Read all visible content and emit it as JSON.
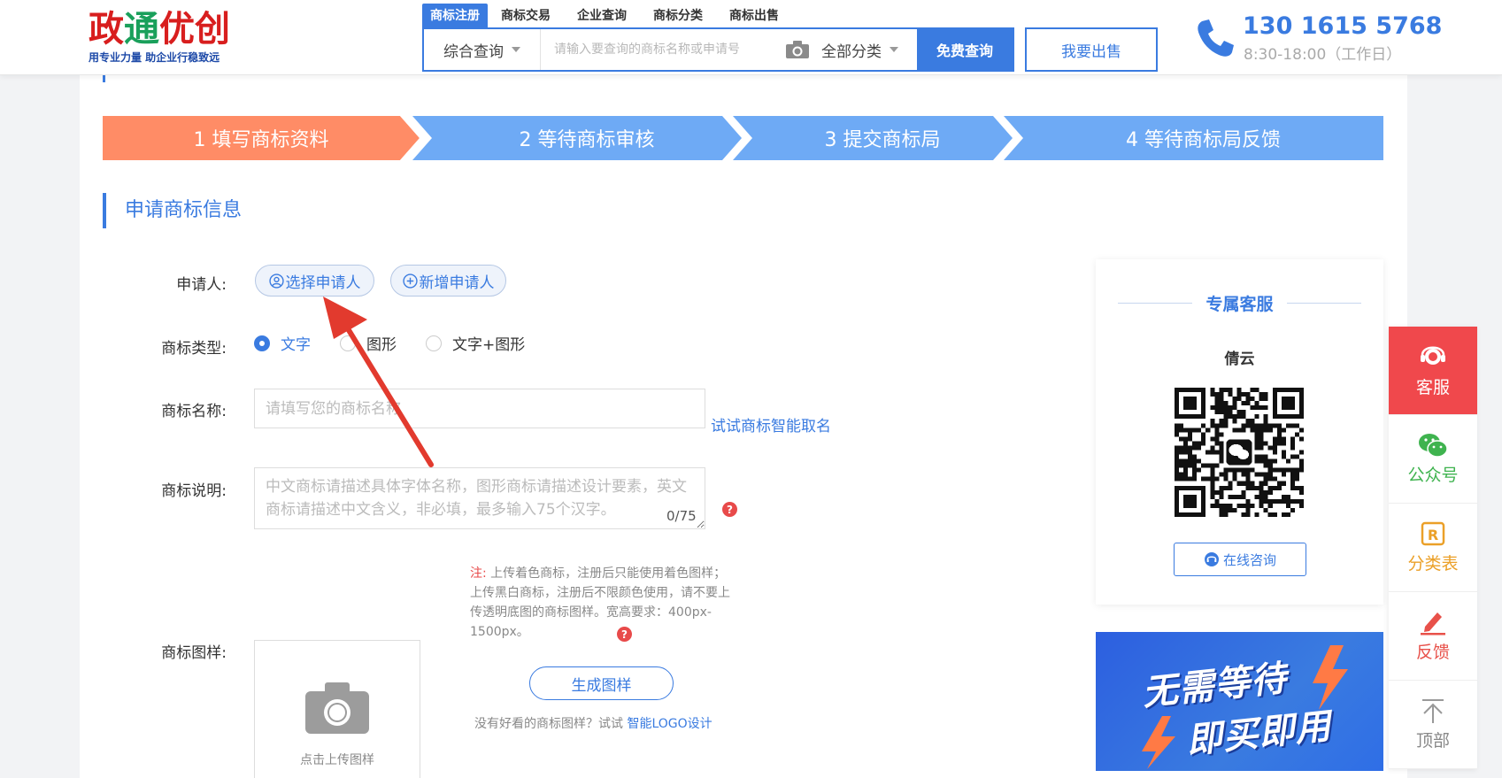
{
  "header": {
    "logo": {
      "title_part1": "政",
      "title_part2": "通",
      "title_part3": "优创",
      "slogan": "用专业力量  助企业行稳致远"
    },
    "tabs": [
      {
        "label": "商标注册",
        "active": true
      },
      {
        "label": "商标交易",
        "active": false
      },
      {
        "label": "企业查询",
        "active": false
      },
      {
        "label": "商标分类",
        "active": false
      },
      {
        "label": "商标出售",
        "active": false
      }
    ],
    "search": {
      "category": "综合查询",
      "placeholder": "请输入要查询的商标名称或申请号",
      "class_select": "全部分类",
      "button": "免费查询"
    },
    "sell_button": "我要出售",
    "phone": "130 1615 5768",
    "hours": "8:30-18:00（工作日）"
  },
  "steps": [
    {
      "label": "1 填写商标资料",
      "active": true
    },
    {
      "label": "2 等待商标审核",
      "active": false
    },
    {
      "label": "3 提交商标局",
      "active": false
    },
    {
      "label": "4 等待商标局反馈",
      "active": false
    }
  ],
  "form": {
    "section_title": "申请商标信息",
    "applicant": {
      "label": "申请人:",
      "select_button": "选择申请人",
      "add_button": "新增申请人"
    },
    "type": {
      "label": "商标类型:",
      "options": [
        {
          "label": "文字",
          "checked": true
        },
        {
          "label": "图形",
          "checked": false
        },
        {
          "label": "文字+图形",
          "checked": false
        }
      ]
    },
    "name": {
      "label": "商标名称:",
      "placeholder": "请填写您的商标名称",
      "ai_link": "试试商标智能取名"
    },
    "desc": {
      "label": "商标说明:",
      "placeholder": "中文商标请描述具体字体名称，图形商标请描述设计要素，英文商标请描述中文含义，非必填，最多输入75个汉字。",
      "counter": "0/75",
      "help": "?"
    },
    "image": {
      "label": "商标图样:",
      "upload_text": "点击上传图样",
      "note_prefix": "注:",
      "note": "上传着色商标，注册后只能使用着色图样；上传黑白商标，注册后不限颜色使用，请不要上传透明底图的商标图样。宽高要求：400px-1500px。",
      "help": "?",
      "generate_button": "生成图样",
      "tip_text": "没有好看的商标图样？试试",
      "tip_link": "智能LOGO设计"
    }
  },
  "service": {
    "title": "专属客服",
    "name": "倩云",
    "consult_button": "在线咨询"
  },
  "banner": {
    "line1": "无需等待",
    "line2": "即买即用"
  },
  "float_bar": [
    {
      "key": "kefu",
      "label": "客服",
      "icon": "headset-icon"
    },
    {
      "key": "gzh",
      "label": "公众号",
      "icon": "wechat-icon"
    },
    {
      "key": "flb",
      "label": "分类表",
      "icon": "registered-icon"
    },
    {
      "key": "fk",
      "label": "反馈",
      "icon": "pen-icon"
    },
    {
      "key": "top",
      "label": "顶部",
      "icon": "arrow-up-icon"
    }
  ],
  "colors": {
    "primary": "#3a7be0",
    "step_active": "#ff8c66",
    "step_inactive": "#6eaaf5",
    "alert_red": "#e84a4a"
  }
}
